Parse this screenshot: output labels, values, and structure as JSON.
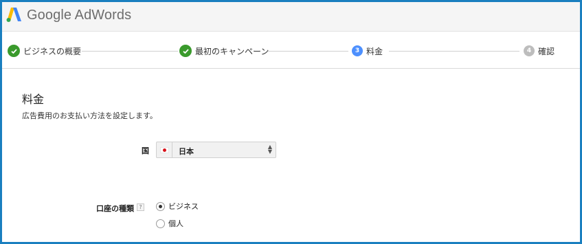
{
  "header": {
    "logo_text": "Google AdWords"
  },
  "stepper": {
    "steps": [
      {
        "label": "ビジネスの概要",
        "status": "done"
      },
      {
        "label": "最初のキャンペーン",
        "status": "done"
      },
      {
        "number": "3",
        "label": "料金",
        "status": "active"
      },
      {
        "number": "4",
        "label": "確認",
        "status": "future"
      }
    ]
  },
  "main": {
    "title": "料金",
    "description": "広告費用のお支払い方法を設定します。",
    "country": {
      "label": "国",
      "selected": "日本"
    },
    "account_type": {
      "label": "口座の種類",
      "help": "?",
      "options": [
        {
          "label": "ビジネス",
          "checked": true
        },
        {
          "label": "個人",
          "checked": false
        }
      ]
    }
  },
  "colors": {
    "frame_border": "#1a7fbf",
    "done_green": "#3a9a2c",
    "active_blue": "#4d90fe",
    "future_gray": "#bdbdbd"
  }
}
